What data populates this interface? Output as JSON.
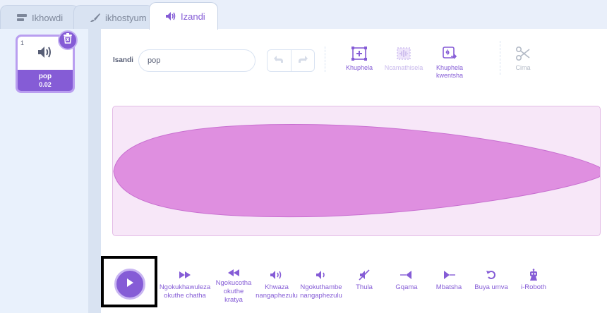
{
  "tabs": [
    {
      "label": "Ikhowdi",
      "icon": "code-icon"
    },
    {
      "label": "ikhostyum",
      "icon": "brush-icon"
    },
    {
      "label": "Izandi",
      "icon": "speaker-icon"
    }
  ],
  "sound_list": [
    {
      "number": "1",
      "name": "pop",
      "duration": "0.02",
      "icon": "speaker-icon"
    }
  ],
  "editor": {
    "sound_label": "Isandi",
    "sound_name_value": "pop",
    "tools": {
      "copy_to_new": "Khuphela",
      "delete": "Ncamathisela",
      "copy_new": "Khuphela kwentsha",
      "cut": "Cima"
    }
  },
  "effects": [
    {
      "label": "Ngokukhawuleza okuthe chatha",
      "icon": "fast-forward-icon"
    },
    {
      "label": "Ngokucotha okuthe kratya",
      "icon": "rewind-icon"
    },
    {
      "label": "Khwaza nangaphezulu",
      "icon": "louder-icon"
    },
    {
      "label": "Ngokuthambe nangaphezulu",
      "icon": "softer-icon"
    },
    {
      "label": "Thula",
      "icon": "mute-icon"
    },
    {
      "label": "Gqama",
      "icon": "fade-in-icon"
    },
    {
      "label": "Mbatsha",
      "icon": "fade-out-icon"
    },
    {
      "label": "Buya umva",
      "icon": "reverse-icon"
    },
    {
      "label": "i-Roboth",
      "icon": "robot-icon"
    }
  ],
  "colors": {
    "accent": "#855cd6",
    "waveform_fill": "#df8fe0",
    "waveform_bg": "#f7e7f8"
  }
}
